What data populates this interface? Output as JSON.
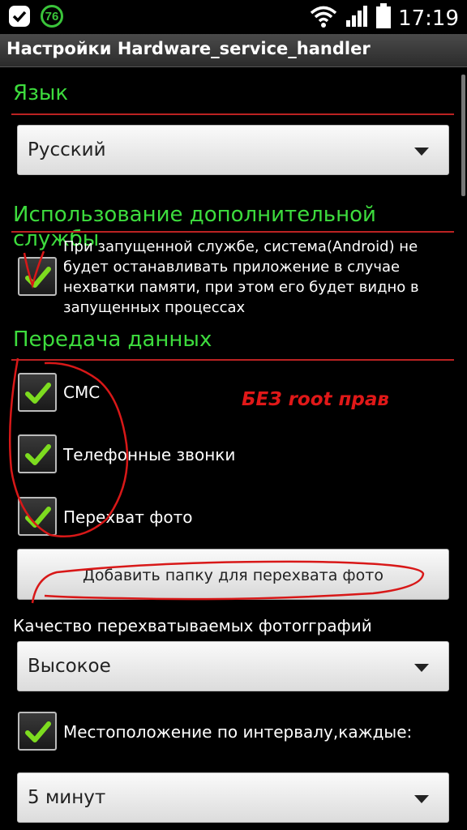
{
  "status_bar": {
    "notification_count": "76",
    "time": "17:19",
    "icons": [
      "check-notification-icon",
      "battery-level-icon",
      "wifi-icon",
      "signal-icon",
      "battery-icon"
    ]
  },
  "title_bar": {
    "title": "Настройки Hardware_service_handler"
  },
  "language_section": {
    "header": "Язык",
    "spinner_value": "Русский"
  },
  "service_section": {
    "header": "Использование дополнительной службы",
    "checkbox_checked": true,
    "checkbox_label": "При запущенной службе, система(Android) не будет останавливать приложение в случае нехватки памяти, при этом его будет видно в запущенных процессах"
  },
  "data_section": {
    "header": "Передача данных",
    "items": [
      {
        "label": "СМС",
        "checked": true
      },
      {
        "label": "Телефонные звонки",
        "checked": true
      },
      {
        "label": "Перехват фото",
        "checked": true
      }
    ],
    "add_folder_button": "Добавить папку для перехвата фото",
    "quality_label": "Качество перехватываемых фотоrграфий",
    "quality_value": "Высокое",
    "location_label": "Местоположение по интервалу,каждые:",
    "location_checked": true,
    "interval_value": "5 минут"
  },
  "annotation": {
    "text": "БЕЗ root прав",
    "color": "#e01818"
  },
  "colors": {
    "section_header": "#3ddc3d",
    "divider": "#bb2222",
    "checkmark": "#7ddc1f"
  }
}
